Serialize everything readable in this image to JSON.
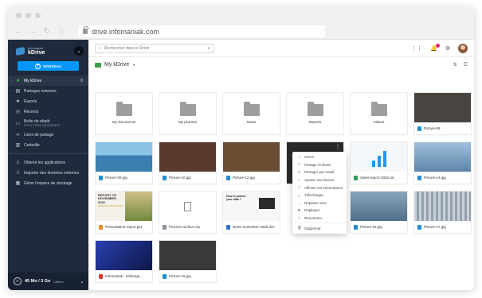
{
  "browser": {
    "url": "drive.infomaniak.com"
  },
  "sidebar": {
    "brand_small": "infomaniak",
    "brand_name": "kDrive",
    "new_button": "NOUVEAU",
    "items": [
      {
        "label": "My kDrive",
        "icon": "folder-icon"
      },
      {
        "label": "Partages externes",
        "icon": "share-icon"
      },
      {
        "label": "Favoris",
        "icon": "star-icon"
      },
      {
        "label": "Récents",
        "icon": "clock-icon"
      },
      {
        "label": "Boîte de dépôt",
        "sublabel": "PRO & TEAM UNIQUEMENT",
        "icon": "inbox-icon"
      },
      {
        "label": "Liens de partage",
        "icon": "link-icon"
      },
      {
        "label": "Corbeille",
        "icon": "trash-icon"
      },
      {
        "label": "Obtenir les applications",
        "icon": "download-icon"
      },
      {
        "label": "Importer des données externes",
        "icon": "import-icon"
      },
      {
        "label": "Gérer l'espace de stockage",
        "icon": "storage-icon"
      }
    ],
    "storage_amount": "45 Mo / 3 Go",
    "storage_used": "utilisés"
  },
  "topbar": {
    "search_placeholder": "Rechercher dans le Drive"
  },
  "toolbar": {
    "breadcrumb": "My kDrive"
  },
  "folders": [
    "My documents",
    "My pictures",
    "News",
    "Reports",
    "Videos"
  ],
  "files": [
    {
      "name": "Picture-08",
      "type": "img",
      "thumb": "#4a4440"
    },
    {
      "name": "Picture-09.jpg",
      "type": "img",
      "thumb": "#4c8fb8"
    },
    {
      "name": "Picture-10.jpg",
      "type": "img",
      "thumb": "#5a3a2c"
    },
    {
      "name": "Picture-12.jpg",
      "type": "img",
      "thumb": "#6a4d33"
    },
    {
      "name": "",
      "type": "",
      "thumb": "#2a2a2a"
    },
    {
      "name": "Sales-report-2020.xls",
      "type": "xls",
      "thumb": "#f5f8fb"
    },
    {
      "name": "Picture-14.jpg",
      "type": "img",
      "thumb": "#7fa7c9"
    },
    {
      "name": "Presentation-report.ppt",
      "type": "ppt",
      "thumb": "#f3f1ea"
    },
    {
      "name": "Pictures archive.zip",
      "type": "zip",
      "thumb": "#ffffff"
    },
    {
      "name": "News-november-2020.doc",
      "type": "doc",
      "thumb": "#f7f7f7"
    },
    {
      "name": "",
      "type": "",
      "thumb": "#ffffff"
    },
    {
      "name": "Picture-16.jpg",
      "type": "img",
      "thumb": "#6f8fa8"
    },
    {
      "name": "Picture-17.jpg",
      "type": "img",
      "thumb": "#a9b4bd"
    },
    {
      "name": "Infomaniak - Héberge...",
      "type": "pdf",
      "thumb": "#1b2b7a"
    },
    {
      "name": "Picture-18.jpg",
      "type": "img",
      "thumb": "#3a3a3a"
    }
  ],
  "thumb_text": {
    "ppt_title": "REPORT OF NOVEMBER 2020",
    "ppt_subtitle": "ECONOMIC AND FINANCE",
    "doc_title": "How to protect your data ?"
  },
  "context_menu": [
    {
      "label": "Ouvrir",
      "icon": "open-icon"
    },
    {
      "label": "Partage et droits",
      "icon": "share-icon"
    },
    {
      "label": "Partager par email",
      "icon": "send-icon"
    },
    {
      "label": "Ajouter aux favoris",
      "icon": "star-icon"
    },
    {
      "label": "Afficher les informations",
      "icon": "info-icon"
    },
    {
      "label": "Télécharger",
      "icon": "download-icon"
    },
    {
      "label": "Déplacer vers",
      "icon": "move-icon"
    },
    {
      "label": "Dupliquer",
      "icon": "copy-icon"
    },
    {
      "label": "Renommer",
      "icon": "edit-icon"
    },
    {
      "label": "Supprimer",
      "icon": "trash-icon"
    }
  ]
}
